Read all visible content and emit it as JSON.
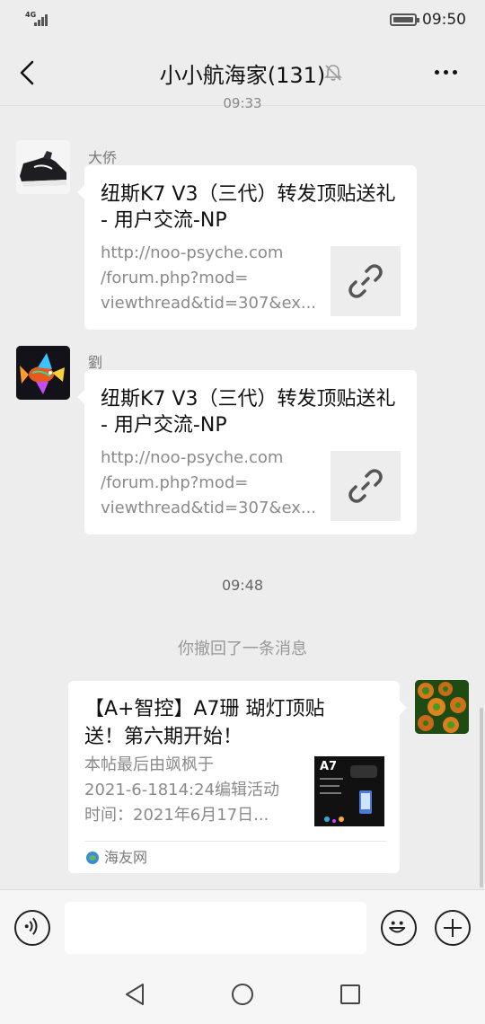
{
  "status_bar": {
    "network": "4G",
    "time": "09:50"
  },
  "header": {
    "title": "小小航海家(131)",
    "muted": true
  },
  "timestamps": {
    "top": "09:33",
    "middle": "09:48"
  },
  "messages": [
    {
      "sender": "大侨",
      "title": "纽斯K7 V3（三代）转发顶贴送礼 - 用户交流-NP",
      "desc_lines": [
        "http://noo-psyche.com",
        "/forum.php?mod=",
        "viewthread&tid=307&ex..."
      ],
      "thumb_icon": "link-icon"
    },
    {
      "sender": "劉",
      "title": "纽斯K7 V3（三代）转发顶贴送礼 - 用户交流-NP",
      "desc_lines": [
        "http://noo-psyche.com",
        "/forum.php?mod=",
        "viewthread&tid=307&ex..."
      ],
      "thumb_icon": "link-icon"
    }
  ],
  "recall_notice": "你撤回了一条消息",
  "own_message": {
    "title": "【A+智控】A7珊 瑚灯顶贴送！第六期开始！",
    "desc_lines": [
      "本帖最后由飒枫于",
      "2021-6-1814:24编辑活动",
      "时间：2021年6月17日..."
    ],
    "thumb_label": "A7",
    "source": "海友网"
  },
  "input": {
    "value": "",
    "placeholder": ""
  },
  "colors": {
    "background": "#ededed",
    "bubble": "#ffffff",
    "link_thumb": "#ededed"
  }
}
